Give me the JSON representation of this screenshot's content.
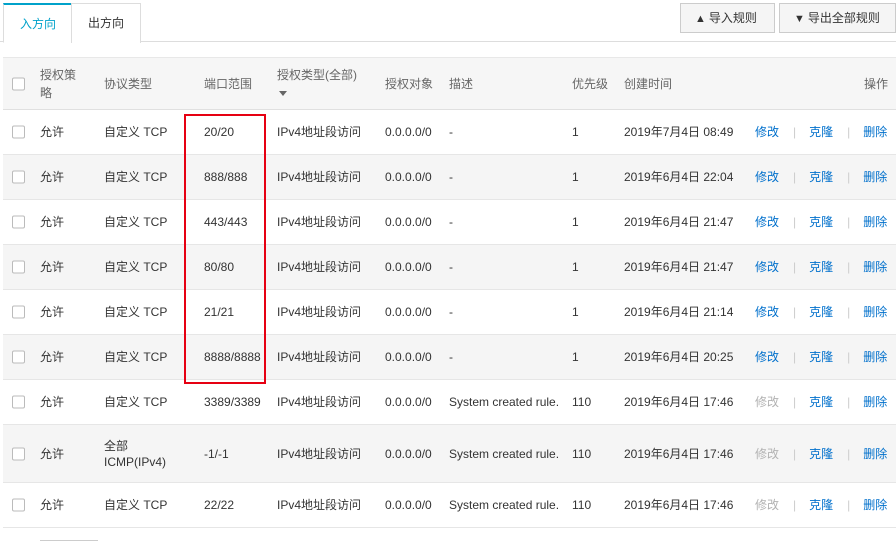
{
  "tabs": {
    "inbound": "入方向",
    "outbound": "出方向"
  },
  "toolbar": {
    "import_label": "导入规则",
    "export_label": "导出全部规则",
    "import_icon": "upload-icon",
    "export_icon": "download-icon"
  },
  "table": {
    "headers": {
      "policy": "授权策略",
      "protocol": "协议类型",
      "port": "端口范围",
      "auth_type": "授权类型(全部)",
      "object": "授权对象",
      "desc": "描述",
      "priority": "优先级",
      "created": "创建时间",
      "ops": "操作"
    },
    "op_labels": {
      "edit": "修改",
      "clone": "克隆",
      "delete": "删除"
    },
    "rows": [
      {
        "policy": "允许",
        "protocol": "自定义 TCP",
        "port": "20/20",
        "auth_type": "IPv4地址段访问",
        "object": "0.0.0.0/0",
        "desc": "-",
        "priority": "1",
        "created": "2019年7月4日 08:49",
        "edit_enabled": true
      },
      {
        "policy": "允许",
        "protocol": "自定义 TCP",
        "port": "888/888",
        "auth_type": "IPv4地址段访问",
        "object": "0.0.0.0/0",
        "desc": "-",
        "priority": "1",
        "created": "2019年6月4日 22:04",
        "edit_enabled": true
      },
      {
        "policy": "允许",
        "protocol": "自定义 TCP",
        "port": "443/443",
        "auth_type": "IPv4地址段访问",
        "object": "0.0.0.0/0",
        "desc": "-",
        "priority": "1",
        "created": "2019年6月4日 21:47",
        "edit_enabled": true
      },
      {
        "policy": "允许",
        "protocol": "自定义 TCP",
        "port": "80/80",
        "auth_type": "IPv4地址段访问",
        "object": "0.0.0.0/0",
        "desc": "-",
        "priority": "1",
        "created": "2019年6月4日 21:47",
        "edit_enabled": true
      },
      {
        "policy": "允许",
        "protocol": "自定义 TCP",
        "port": "21/21",
        "auth_type": "IPv4地址段访问",
        "object": "0.0.0.0/0",
        "desc": "-",
        "priority": "1",
        "created": "2019年6月4日 21:14",
        "edit_enabled": true
      },
      {
        "policy": "允许",
        "protocol": "自定义 TCP",
        "port": "8888/8888",
        "auth_type": "IPv4地址段访问",
        "object": "0.0.0.0/0",
        "desc": "-",
        "priority": "1",
        "created": "2019年6月4日 20:25",
        "edit_enabled": true
      },
      {
        "policy": "允许",
        "protocol": "自定义 TCP",
        "port": "3389/3389",
        "auth_type": "IPv4地址段访问",
        "object": "0.0.0.0/0",
        "desc": "System created rule.",
        "priority": "110",
        "created": "2019年6月4日 17:46",
        "edit_enabled": false
      },
      {
        "policy": "允许",
        "protocol": "全部\nICMP(IPv4)",
        "port": "-1/-1",
        "auth_type": "IPv4地址段访问",
        "object": "0.0.0.0/0",
        "desc": "System created rule.",
        "priority": "110",
        "created": "2019年6月4日 17:46",
        "edit_enabled": false
      },
      {
        "policy": "允许",
        "protocol": "自定义 TCP",
        "port": "22/22",
        "auth_type": "IPv4地址段访问",
        "object": "0.0.0.0/0",
        "desc": "System created rule.",
        "priority": "110",
        "created": "2019年6月4日 17:46",
        "edit_enabled": false
      }
    ]
  },
  "colors": {
    "accent": "#00a2ca",
    "link": "#0070cc",
    "highlight": "#e60012",
    "disabled": "#b2b2b2"
  }
}
